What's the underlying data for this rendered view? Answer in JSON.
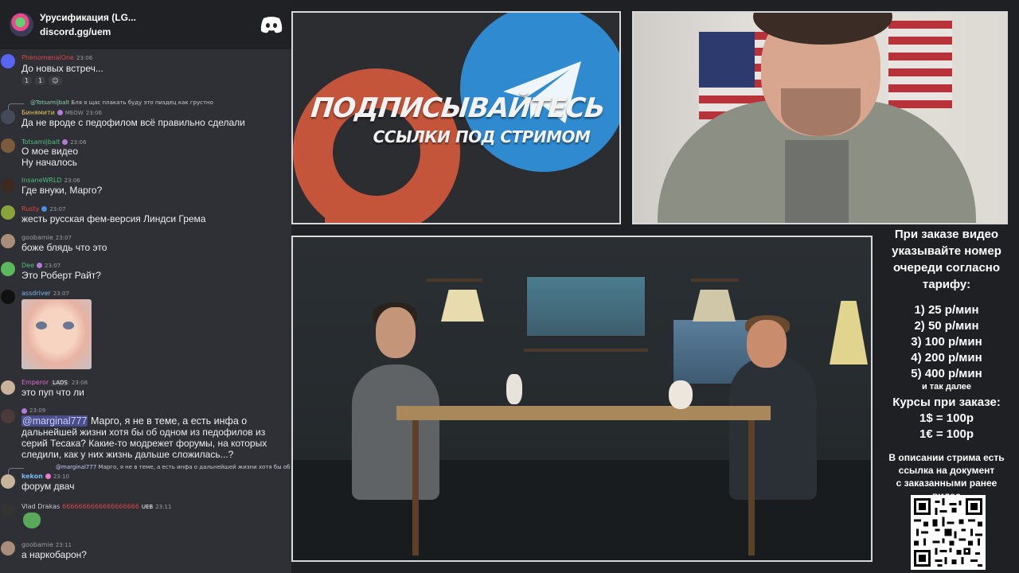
{
  "server": {
    "name": "Урусификация (LG...",
    "invite": "discord.gg/uem"
  },
  "messages": [
    {
      "user": "PhenomenalOne",
      "time": "23:06",
      "text": "До новых встреч...",
      "reactions": [
        "1",
        "1",
        ""
      ]
    },
    {
      "user": "Бинямити",
      "time": "23:06",
      "badge": "MEOW",
      "reply_user": "@Totsamijbalt",
      "reply_text": "Бля я щас плакать буду это пиздец как грустно",
      "text": "Да не вроде с педофилом всё правильно сделали"
    },
    {
      "user": "Totsamijbalt",
      "time": "23:06",
      "text": "О мое видео",
      "text2": "Ну началось"
    },
    {
      "user": "InsaneWRLD",
      "time": "23:06",
      "text": "Где внуки, Марго?"
    },
    {
      "user": "Rusty",
      "time": "23:07",
      "text": "жесть русская фем-версия Линдси Грема"
    },
    {
      "user": "goobamie",
      "time": "23:07",
      "text": "боже блядь что это"
    },
    {
      "user": "Dee",
      "time": "23:07",
      "text": "Это Роберт Райт?"
    },
    {
      "user": "assdriver",
      "time": "23:07"
    },
    {
      "user": "Emperor",
      "time": "23:08",
      "badge": "LADS",
      "text": "это пуп что ли"
    },
    {
      "user": "",
      "time": "23:09",
      "mention": "@marginal777",
      "text": " Марго, я не в теме, а есть инфа о",
      "text2": "дальнейшей жизни  хотя бы об одном из педофилов из",
      "text3": "серий Тесака?  Какие-то модрежет форумы,  на которых",
      "text4": "следили, как у них жизнь дальше сложилась...?"
    },
    {
      "user": "kekon",
      "time": "23:10",
      "reply_user": "@marginal777",
      "reply_text": "Марго, я не в теме, а есть инфа о дальнейшей жизни  хотя бы об одном из",
      "text": "форум  двач"
    },
    {
      "user": "Vlad Drakas",
      "time": "23:11",
      "badge": "UEB",
      "spam": "6666666666666666666"
    },
    {
      "user": "goobamie",
      "time": "23:11",
      "text": "а наркобарон?"
    }
  ],
  "banner": {
    "title": "ПОДПИСЫВАЙТЕСЬ",
    "subtitle": "ССЫЛКИ ПОД СТРИМОМ"
  },
  "info": {
    "heading": [
      "При заказе видео",
      "указывайте номер",
      "очереди согласно",
      "тарифу:"
    ],
    "rates": [
      "1) 25 р/мин",
      "2) 50 р/мин",
      "3) 100 р/мин",
      "4) 200 р/мин",
      "5) 400 р/мин"
    ],
    "etc": "и так далее",
    "courses_title": "Курсы при заказе:",
    "course1": "1$ = 100р",
    "course2": "1€ = 100р",
    "desc": [
      "В описании стрима есть",
      "ссылка на документ",
      "с заказанными ранее",
      "видео"
    ]
  },
  "colors": {
    "chat_bg": "#2e3035",
    "header_bg": "#202125",
    "frame_border": "#d7d8da",
    "patreon_red": "#c5553a",
    "telegram_blue": "#2f8ad0"
  }
}
